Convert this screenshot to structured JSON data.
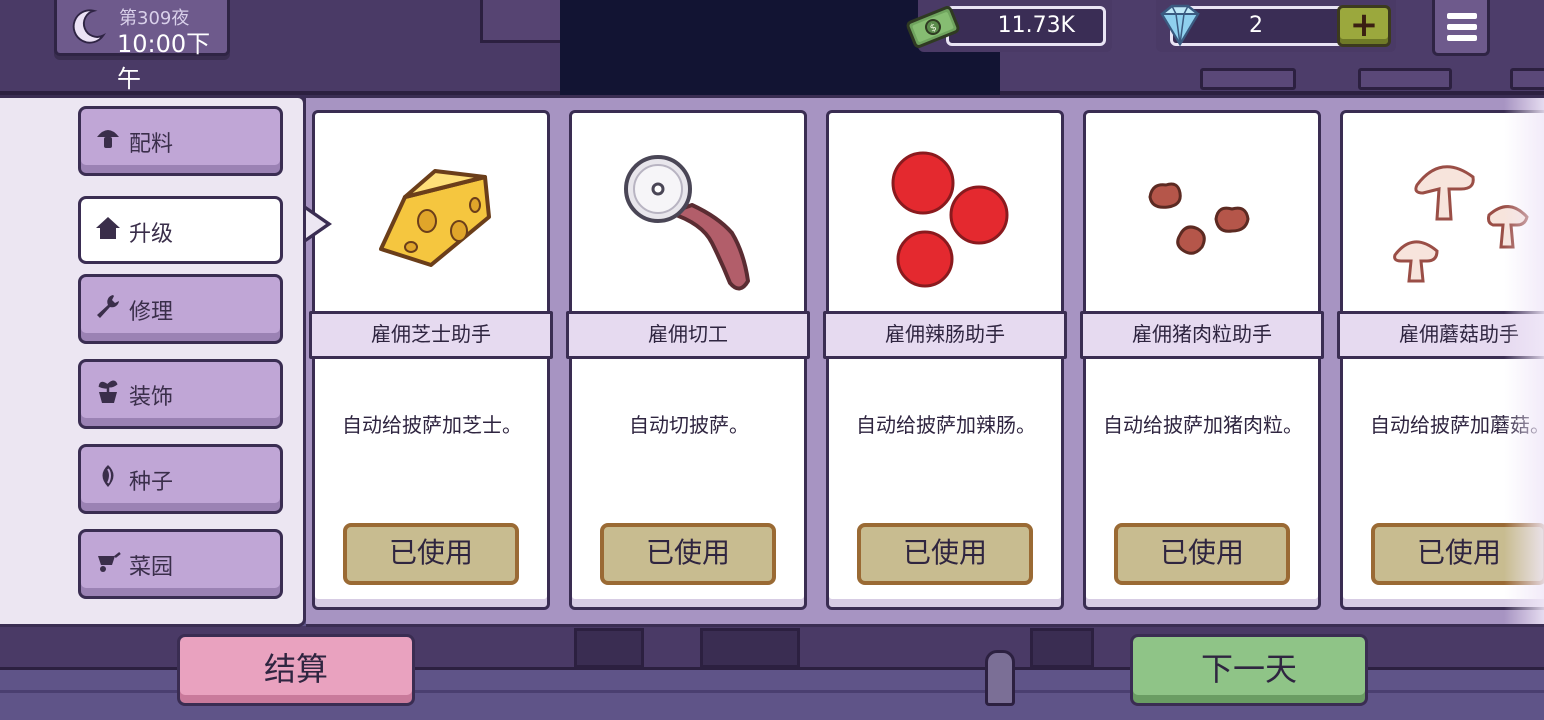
{
  "hud": {
    "day_label": "第309夜",
    "time_label": "10:00下午",
    "money": "11.73K",
    "gems": "2",
    "plus_label": "+"
  },
  "categories": [
    {
      "label": "配料",
      "icon": "mushroom-icon"
    },
    {
      "label": "升级",
      "icon": "house-icon",
      "active": true
    },
    {
      "label": "修理",
      "icon": "wrench-icon"
    },
    {
      "label": "装饰",
      "icon": "potted-plant-icon"
    },
    {
      "label": "种子",
      "icon": "seed-icon"
    },
    {
      "label": "菜园",
      "icon": "wheelbarrow-icon"
    }
  ],
  "cards": [
    {
      "title": "雇佣芝士助手",
      "desc": "自动给披萨加芝士。",
      "button": "已使用",
      "icon": "cheese-icon"
    },
    {
      "title": "雇佣切工",
      "desc": "自动切披萨。",
      "button": "已使用",
      "icon": "pizza-cutter-icon"
    },
    {
      "title": "雇佣辣肠助手",
      "desc": "自动给披萨加辣肠。",
      "button": "已使用",
      "icon": "pepperoni-icon"
    },
    {
      "title": "雇佣猪肉粒助手",
      "desc": "自动给披萨加猪肉粒。",
      "button": "已使用",
      "icon": "sausage-crumbles-icon"
    },
    {
      "title": "雇佣蘑菇助手",
      "desc": "自动给披萨加蘑菇。",
      "button": "已使用",
      "icon": "mushrooms-icon"
    }
  ],
  "bottom": {
    "settle_label": "结算",
    "next_day_label": "下一天"
  },
  "colors": {
    "panel_bg": "#a794c2",
    "category_button": "#c0a6d6",
    "used_button": "#c8bc90",
    "settle_button": "#e9a2bf",
    "next_day_button": "#8fc487",
    "plus_button": "#9ba83d"
  }
}
